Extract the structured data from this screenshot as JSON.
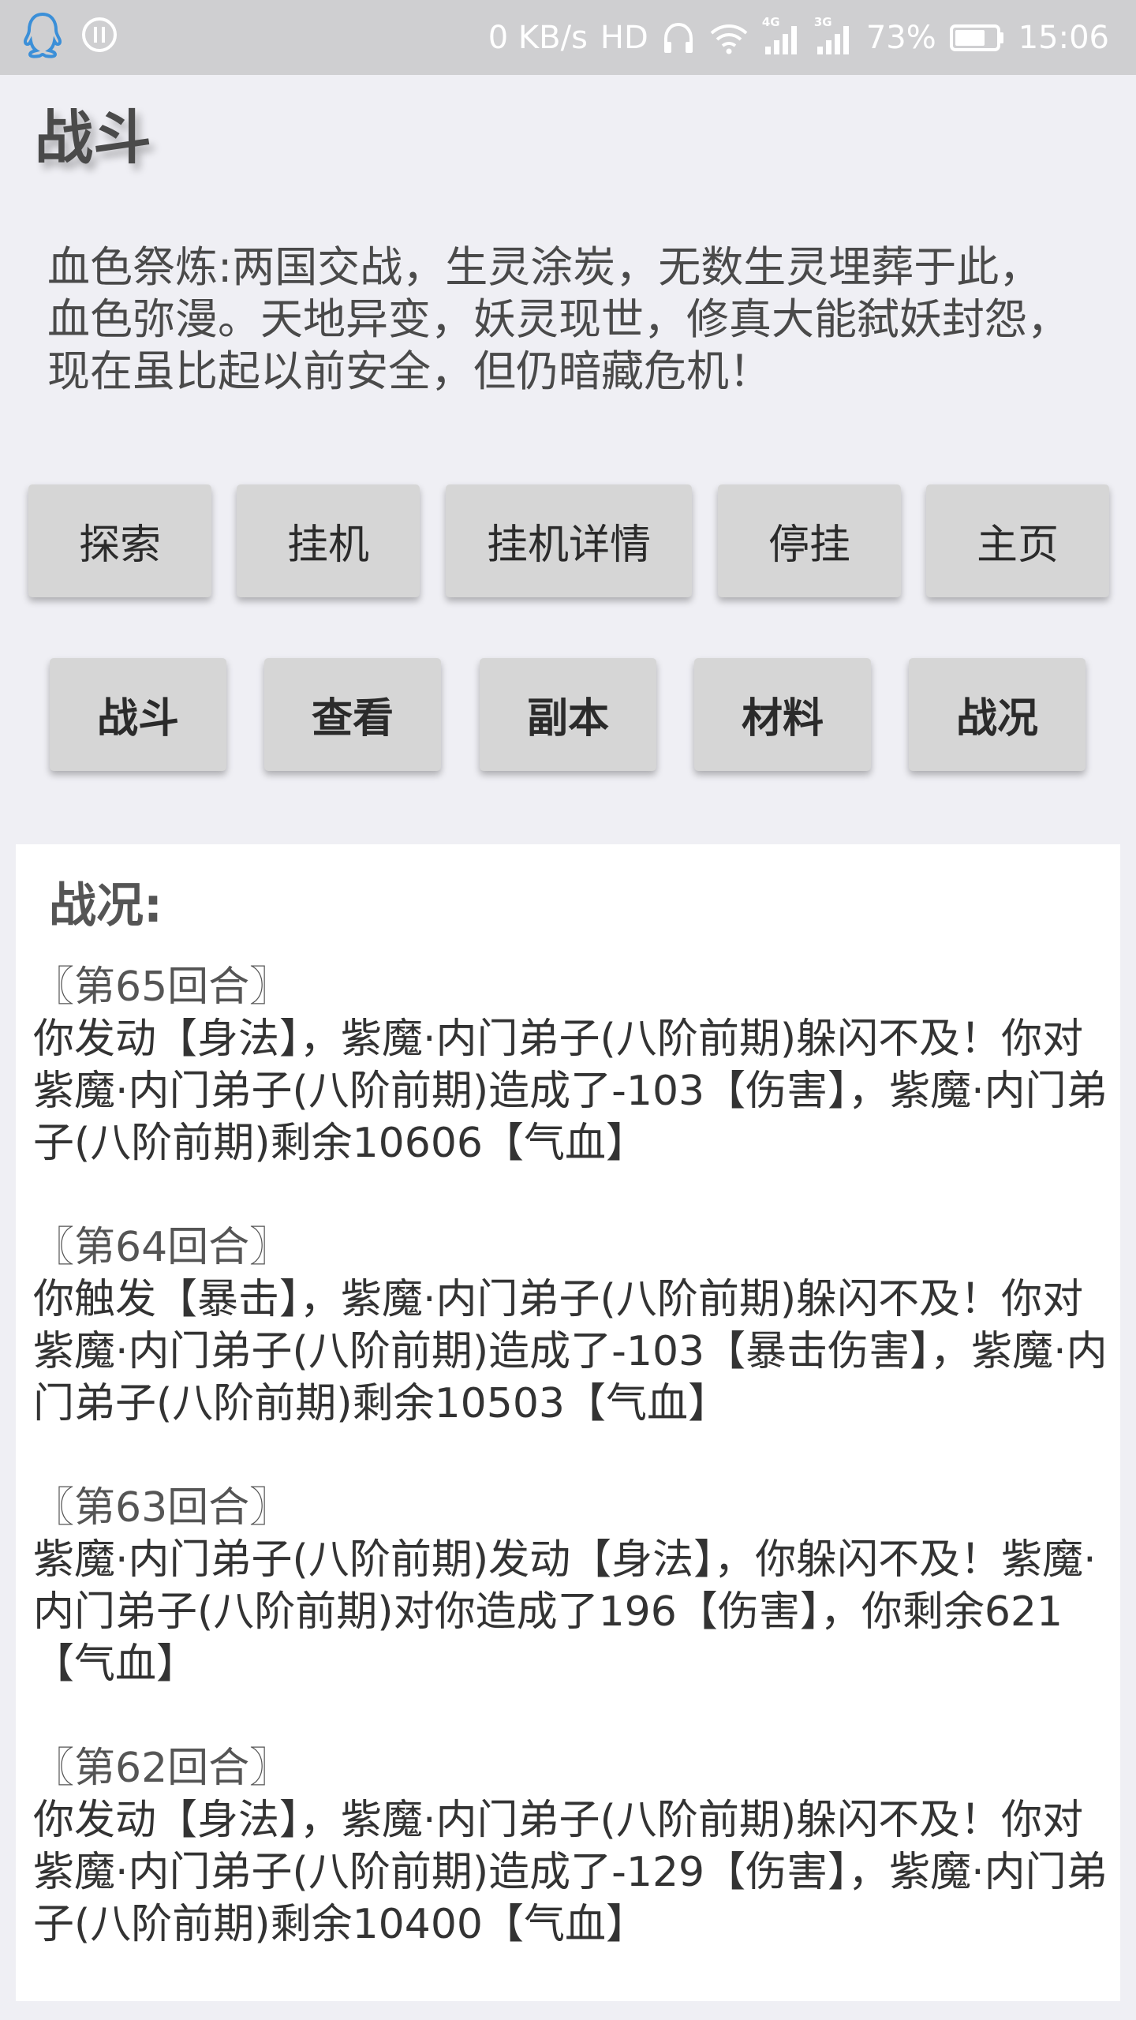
{
  "status_bar": {
    "network_speed": "0 KB/s",
    "hd_label": "HD",
    "signal_1_label": "4G",
    "signal_2_label": "3G",
    "battery_percent": "73%",
    "battery_level": 0.73,
    "time": "15:06",
    "icons": [
      "qq-icon",
      "usb-debug-icon",
      "headphone-icon",
      "wifi-icon",
      "signal-4g-icon",
      "signal-3g-icon",
      "battery-icon"
    ]
  },
  "page": {
    "title": "战斗",
    "description": "血色祭炼:两国交战，生灵涂炭，无数生灵埋葬于此，血色弥漫。天地异变，妖灵现世，修真大能弑妖封怨，现在虽比起以前安全，但仍暗藏危机！"
  },
  "buttons": {
    "row1": [
      "探索",
      "挂机",
      "挂机详情",
      "停挂",
      "主页"
    ],
    "row2": [
      "战斗",
      "查看",
      "副本",
      "材料",
      "战况"
    ]
  },
  "battle_log": {
    "heading": "战况:",
    "entries": [
      {
        "round": "〖第65回合〗",
        "text": "你发动【身法】，紫魔·内门弟子(八阶前期)躲闪不及！你对紫魔·内门弟子(八阶前期)造成了-103【伤害】，紫魔·内门弟子(八阶前期)剩余10606【气血】"
      },
      {
        "round": "〖第64回合〗",
        "text": "你触发【暴击】，紫魔·内门弟子(八阶前期)躲闪不及！你对紫魔·内门弟子(八阶前期)造成了-103【暴击伤害】，紫魔·内门弟子(八阶前期)剩余10503【气血】"
      },
      {
        "round": "〖第63回合〗",
        "text": "紫魔·内门弟子(八阶前期)发动【身法】，你躲闪不及！紫魔·内门弟子(八阶前期)对你造成了196【伤害】，你剩余621【气血】"
      },
      {
        "round": "〖第62回合〗",
        "text": "你发动【身法】，紫魔·内门弟子(八阶前期)躲闪不及！你对紫魔·内门弟子(八阶前期)造成了-129【伤害】，紫魔·内门弟子(八阶前期)剩余10400【气血】"
      }
    ]
  },
  "colors": {
    "status_bar_bg": "#cfcfd1",
    "page_bg": "#efeff4",
    "button_bg": "#d6d6d6",
    "panel_bg": "#ffffff",
    "qq_icon": "#3b8fd8"
  }
}
